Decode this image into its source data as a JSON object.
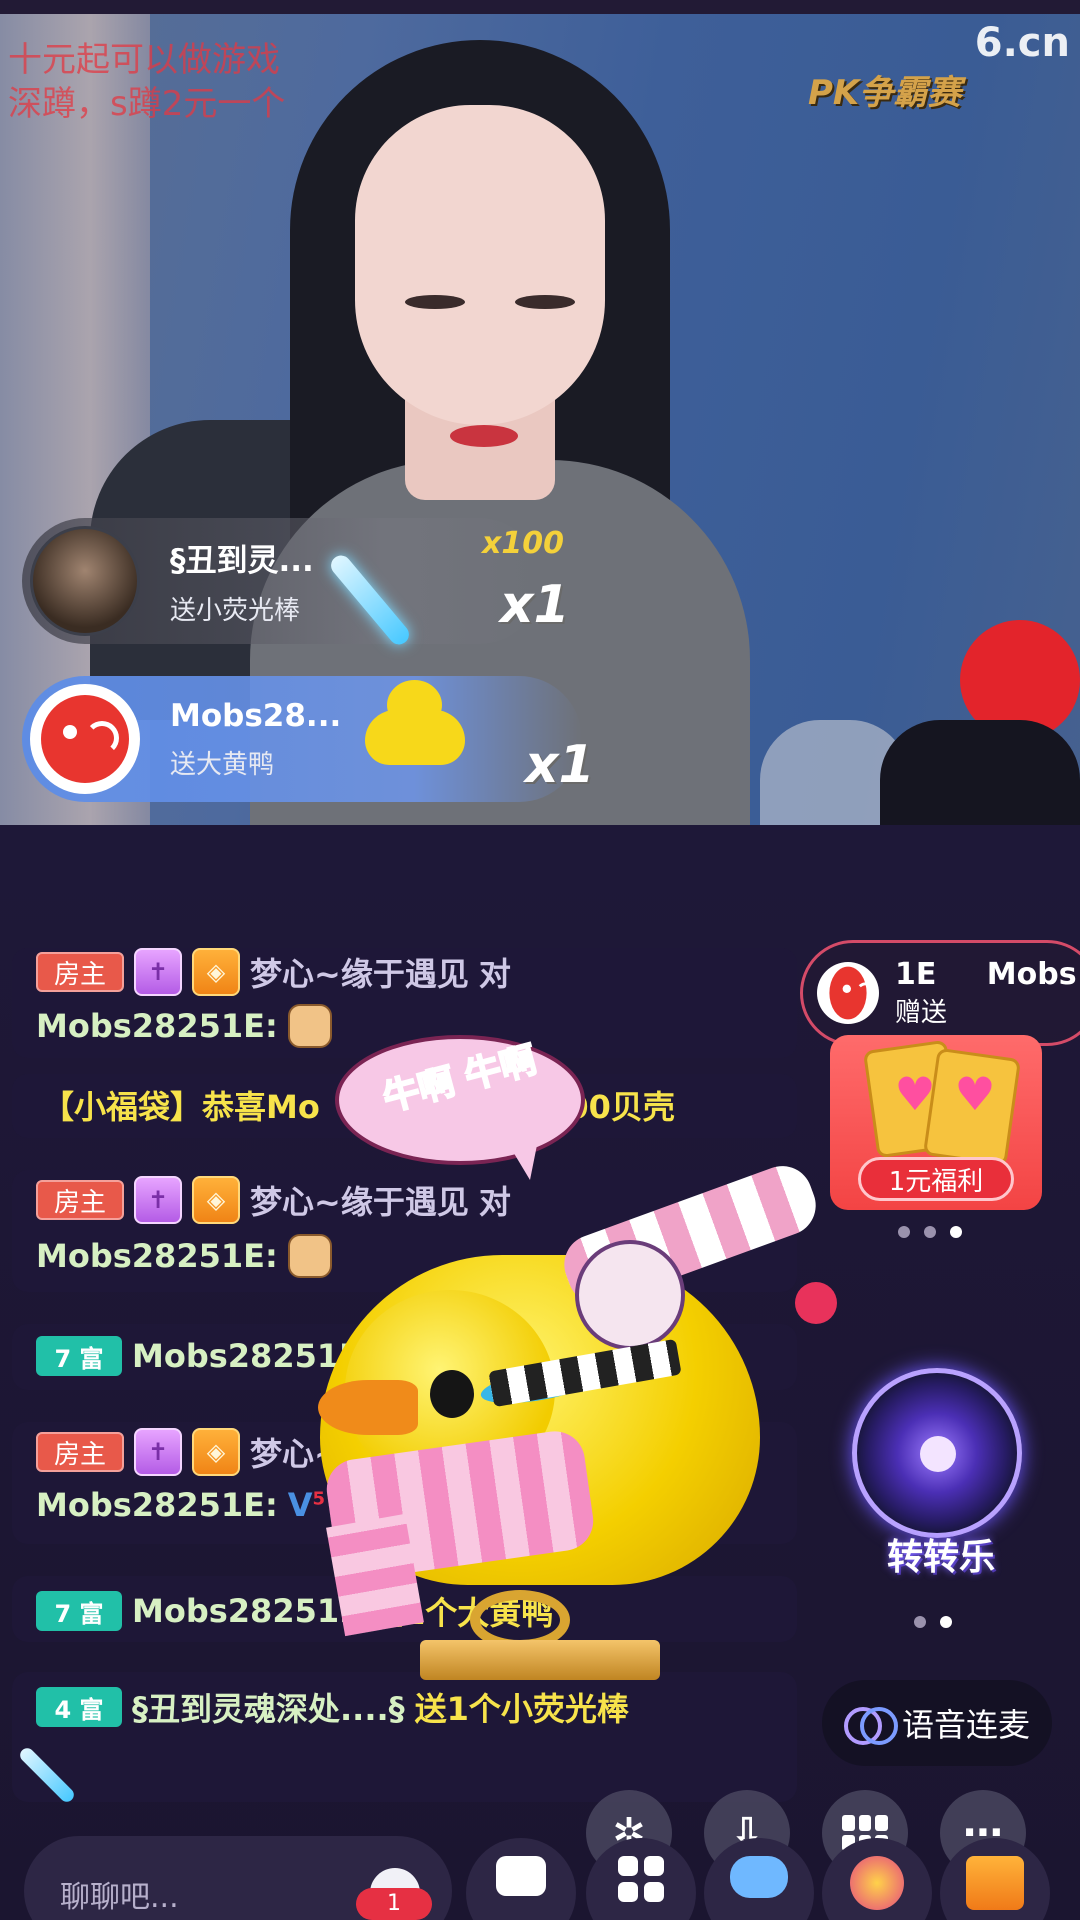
{
  "overlay": {
    "promo_line1": "十元起可以做游戏",
    "promo_line2": "深蹲，s蹲2元一个",
    "site_logo": "6.cn",
    "pk_label": "PK争霸赛"
  },
  "gift_banners": [
    {
      "name": "§丑到灵...",
      "action": "送小荧光棒",
      "count": "x1",
      "multiplier": "x100"
    },
    {
      "name": "Mobs28...",
      "action": "送大黄鸭",
      "count": "x1"
    }
  ],
  "chat": [
    {
      "badges": [
        "房主"
      ],
      "sender": "梦心~缘于遇见",
      "verb": "对",
      "line2": "Mobs28251E:"
    },
    {
      "text": "【小福袋】恭喜Mo",
      "text_tail": "得6000贝壳"
    },
    {
      "badges": [
        "房主"
      ],
      "sender": "梦心~缘于遇见",
      "verb": "对",
      "line2": "Mobs28251E:"
    },
    {
      "rich_level": "7 富",
      "sender": "Mobs28251E"
    },
    {
      "badges": [
        "房主"
      ],
      "sender": "梦心~缘",
      "line2": "Mobs28251E:",
      "emoji_text": "5"
    },
    {
      "rich_level": "7 富",
      "sender": "Mobs28251E",
      "tail": "送1个大黄鸭"
    },
    {
      "rich_level": "4 富",
      "sender": "§丑到灵魂深处....§",
      "tail": "送1个小荧光棒"
    }
  ],
  "gift_toast": {
    "line1": "1E Mobs",
    "line2": "赠送"
  },
  "fuli_button": "1元福利",
  "speech_bubble": "牛啊 牛啊",
  "wheel_label": "转转乐",
  "voice_button": "语音连麦",
  "input_placeholder": "聊聊吧...",
  "notification_count": "1",
  "colors": {
    "host_badge": "#e8594a",
    "rich_badge": "#21c0a8",
    "accent_yellow": "#f7e34b"
  }
}
